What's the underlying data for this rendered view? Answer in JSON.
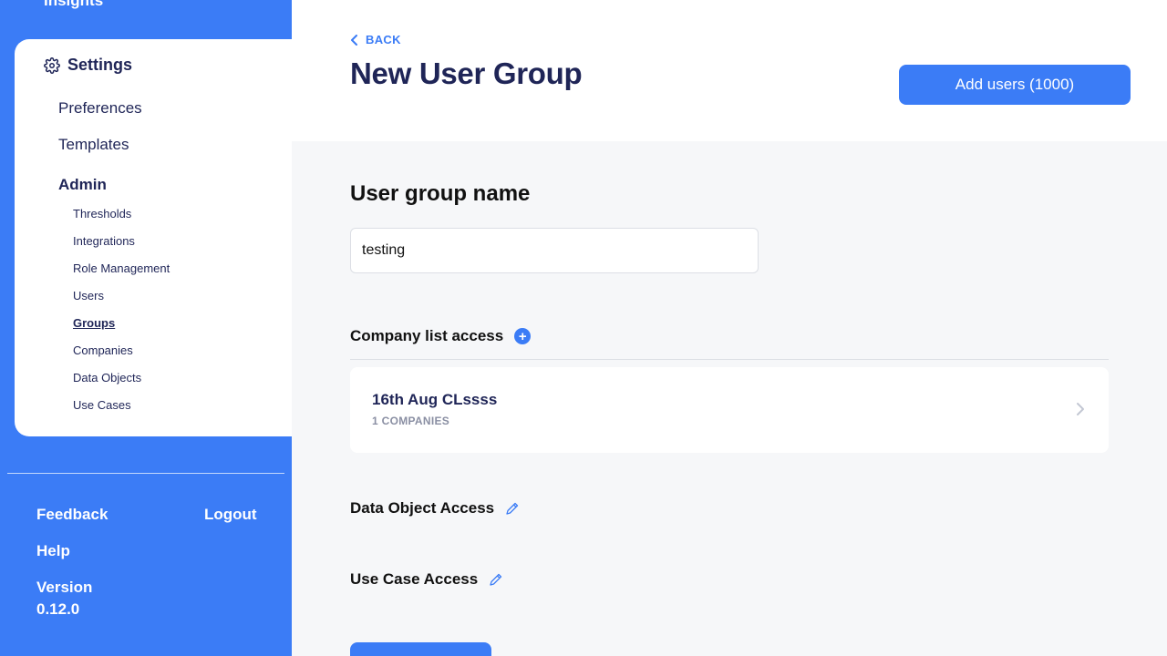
{
  "sidebar": {
    "top_item": "Insights",
    "settings_title": "Settings",
    "items": [
      "Preferences",
      "Templates"
    ],
    "admin_label": "Admin",
    "admin_items": [
      "Thresholds",
      "Integrations",
      "Role Management",
      "Users",
      "Groups",
      "Companies",
      "Data Objects",
      "Use Cases"
    ],
    "active_admin_item": "Groups",
    "footer": {
      "feedback": "Feedback",
      "logout": "Logout",
      "help": "Help",
      "version_label": "Version",
      "version_value": "0.12.0"
    }
  },
  "header": {
    "back_label": "BACK",
    "title": "New User Group",
    "add_users_label": "Add users (1000)"
  },
  "main": {
    "group_name_title": "User group name",
    "group_name_value": "testing",
    "company_access_title": "Company list access",
    "company_lists": [
      {
        "name": "16th Aug CLssss",
        "count_label": "1 COMPANIES"
      }
    ],
    "data_object_access_title": "Data Object Access",
    "use_case_access_title": "Use Case Access"
  },
  "colors": {
    "accent": "#3b7cf6",
    "navy": "#1f2557",
    "background": "#f6f7f9"
  },
  "icons": [
    "gear-icon",
    "chevron-left-icon",
    "plus-circle-icon",
    "chevron-right-icon",
    "pencil-icon"
  ]
}
